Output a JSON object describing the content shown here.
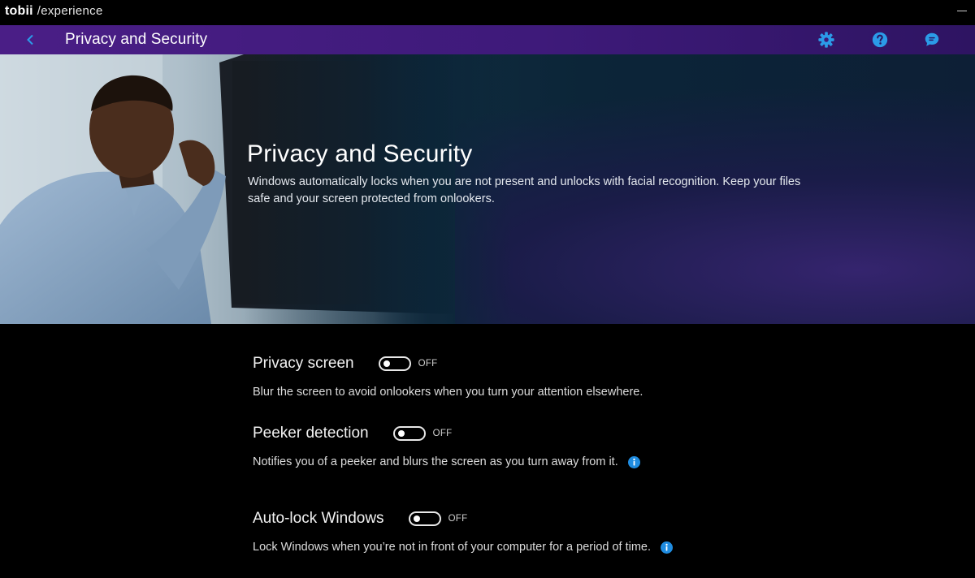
{
  "app": {
    "brand": "tobii",
    "subtitle": "/experience"
  },
  "header": {
    "title": "Privacy and Security",
    "icons": [
      "back-icon",
      "gear-icon",
      "help-icon",
      "chat-icon"
    ],
    "accent_color": "#4a1e86",
    "icon_color": "#2b9be8"
  },
  "hero": {
    "title": "Privacy and Security",
    "description": "Windows automatically locks when you are not present and unlocks with facial recognition. Keep your files safe and your screen protected from onlookers."
  },
  "settings": [
    {
      "label": "Privacy screen",
      "state": "OFF",
      "enabled": false,
      "description": "Blur the screen to avoid onlookers when you turn your attention elsewhere.",
      "info": false
    },
    {
      "label": "Peeker detection",
      "state": "OFF",
      "enabled": false,
      "description": "Notifies you of a peeker and blurs the screen as you turn away from it.",
      "info": true
    },
    {
      "label": "Auto-lock Windows",
      "state": "OFF",
      "enabled": false,
      "description": "Lock Windows when you’re not in front of your computer for a period of time.",
      "info": true
    }
  ]
}
